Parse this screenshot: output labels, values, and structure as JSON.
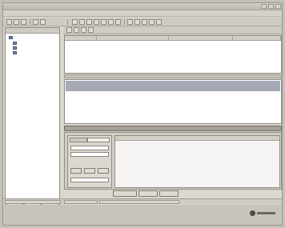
{
  "window": {
    "title": ""
  },
  "menu": {
    "items": [
      "",
      "",
      "",
      "",
      "",
      "",
      "",
      "",
      "",
      ""
    ]
  },
  "tree": {
    "root_label": "",
    "children": [
      "",
      "",
      ""
    ]
  },
  "message_list": {
    "columns": [
      "",
      "",
      "",
      ""
    ]
  },
  "reading_pane": {
    "pane_label": "",
    "subject": "",
    "from": "",
    "greeting": "",
    "body": "",
    "signoff": ""
  },
  "dock": {
    "title": "",
    "tabs": [
      "",
      ""
    ],
    "right_panel_header": "",
    "buttons": [
      "",
      "",
      ""
    ]
  },
  "status_bar": {
    "text": ""
  },
  "icons": {
    "tree_item": "folder-icon",
    "toolbar": "toolbar-icon",
    "logo": "brand-logo-icon"
  },
  "colors": {
    "window_bg": "#dcd8d0",
    "header_strip": "#a5a9b6",
    "tree_text": "#23327a",
    "dock_title": "#a6a29a"
  }
}
